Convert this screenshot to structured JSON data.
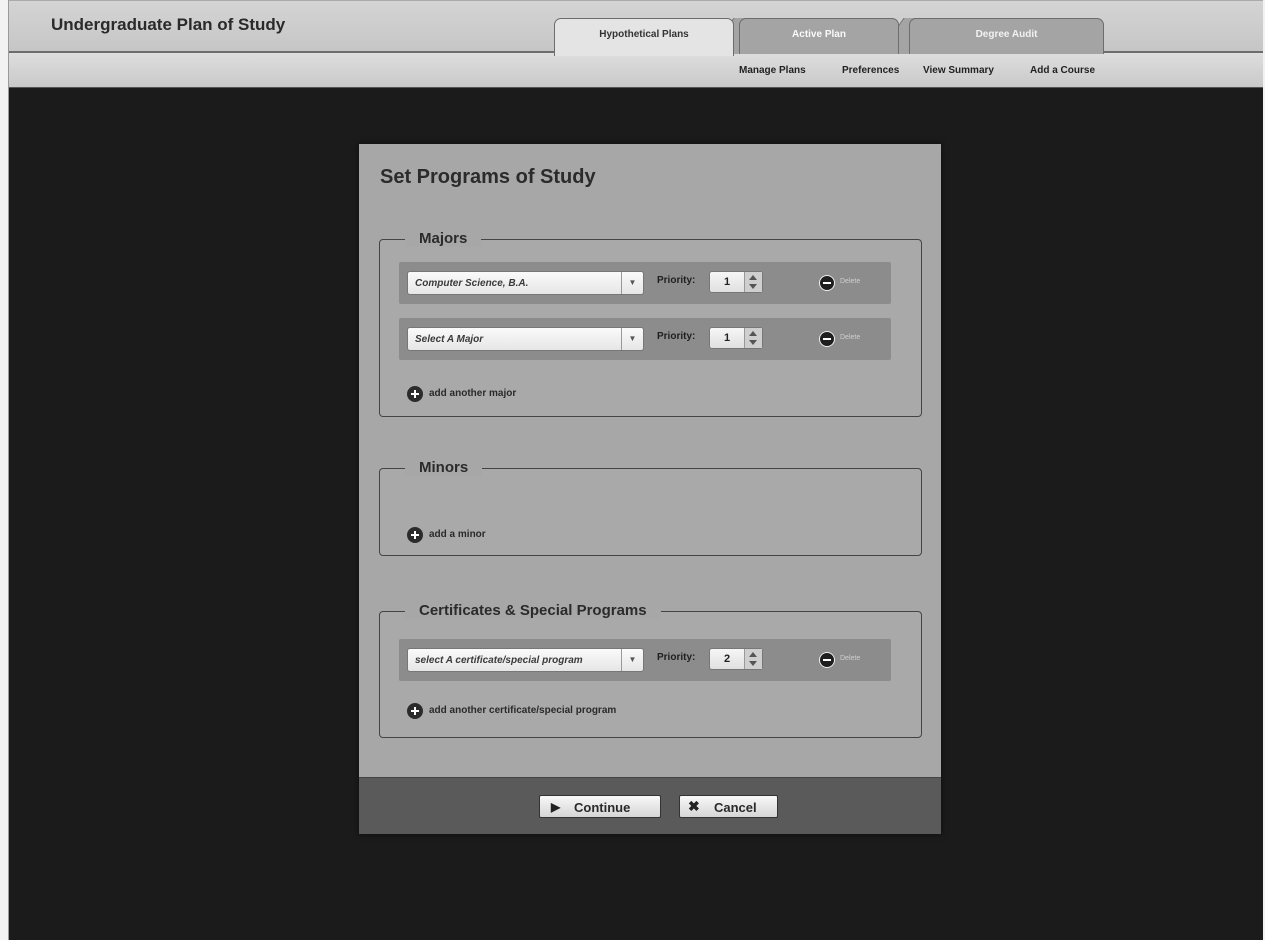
{
  "app": {
    "title": "Undergraduate Plan of Study"
  },
  "tabs": [
    {
      "label": "Hypothetical Plans",
      "active": true
    },
    {
      "label": "Active Plan",
      "active": false
    },
    {
      "label": "Degree Audit",
      "active": false
    }
  ],
  "subnav": [
    {
      "label": "Manage Plans"
    },
    {
      "label": "Preferences"
    },
    {
      "label": "View Summary"
    },
    {
      "label": "Add a Course"
    }
  ],
  "modal": {
    "title": "Set Programs of Study",
    "majors": {
      "legend": "Majors",
      "rows": [
        {
          "select": "Computer Science, B.A.",
          "priority_label": "Priority:",
          "priority": "1",
          "delete_label": "Delete"
        },
        {
          "select": "Select A Major",
          "priority_label": "Priority:",
          "priority": "1",
          "delete_label": "Delete"
        }
      ],
      "add_label": "add another major"
    },
    "minors": {
      "legend": "Minors",
      "add_label": "add a minor"
    },
    "certificates": {
      "legend": "Certificates & Special Programs",
      "rows": [
        {
          "select": "select A certificate/special program",
          "priority_label": "Priority:",
          "priority": "2",
          "delete_label": "Delete"
        }
      ],
      "add_label": "add another certificate/special program"
    },
    "footer": {
      "continue_label": "Continue",
      "cancel_label": "Cancel"
    }
  },
  "icons": {
    "continue": "play-icon",
    "cancel": "x-icon",
    "add": "plus-circle-icon",
    "delete": "minus-circle-icon"
  }
}
